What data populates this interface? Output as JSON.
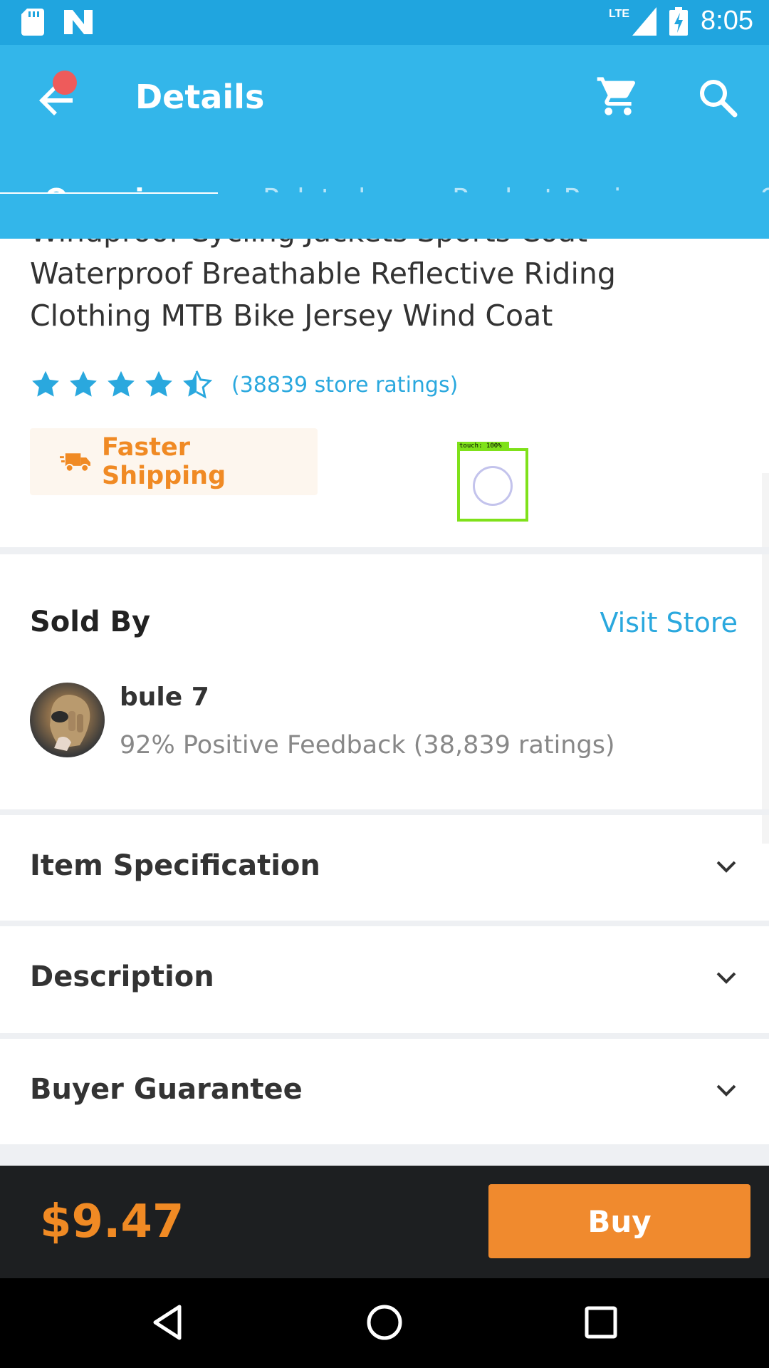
{
  "status_bar": {
    "network": "LTE",
    "time": "8:05",
    "icons": [
      "sd-card-icon",
      "n-logo-icon",
      "signal-icon",
      "battery-charging-icon"
    ]
  },
  "header": {
    "title": "Details",
    "icons": [
      "back-arrow-icon",
      "cart-icon",
      "search-icon"
    ],
    "notification_color": "#ee5b5b"
  },
  "tabs": [
    {
      "label": "Overview",
      "active": true
    },
    {
      "label": "Related",
      "active": false
    },
    {
      "label": "Product Reviews",
      "active": false
    },
    {
      "label": "S",
      "active": false
    }
  ],
  "product": {
    "title": "Windproof Cycling Jackets Sports Coat Waterproof Breathable Reflective Riding Clothing MTB Bike Jersey Wind Coat",
    "rating_stars": 4.5,
    "ratings_text": "(38839 store ratings)",
    "shipping_badge": "Faster Shipping"
  },
  "touch_overlay": {
    "label": "touch: 100%"
  },
  "seller": {
    "section_title": "Sold By",
    "visit_store": "Visit Store",
    "name": "bule 7",
    "feedback": "92% Positive Feedback (38,839 ratings)"
  },
  "sections": [
    {
      "label": "Item Specification"
    },
    {
      "label": "Description"
    },
    {
      "label": "Buyer Guarantee"
    }
  ],
  "buy_bar": {
    "price": "$9.47",
    "buy_label": "Buy"
  },
  "colors": {
    "primary": "#33b6ea",
    "status_bar": "#20a5df",
    "accent_orange": "#f08a24",
    "link_blue": "#2aa8de"
  }
}
